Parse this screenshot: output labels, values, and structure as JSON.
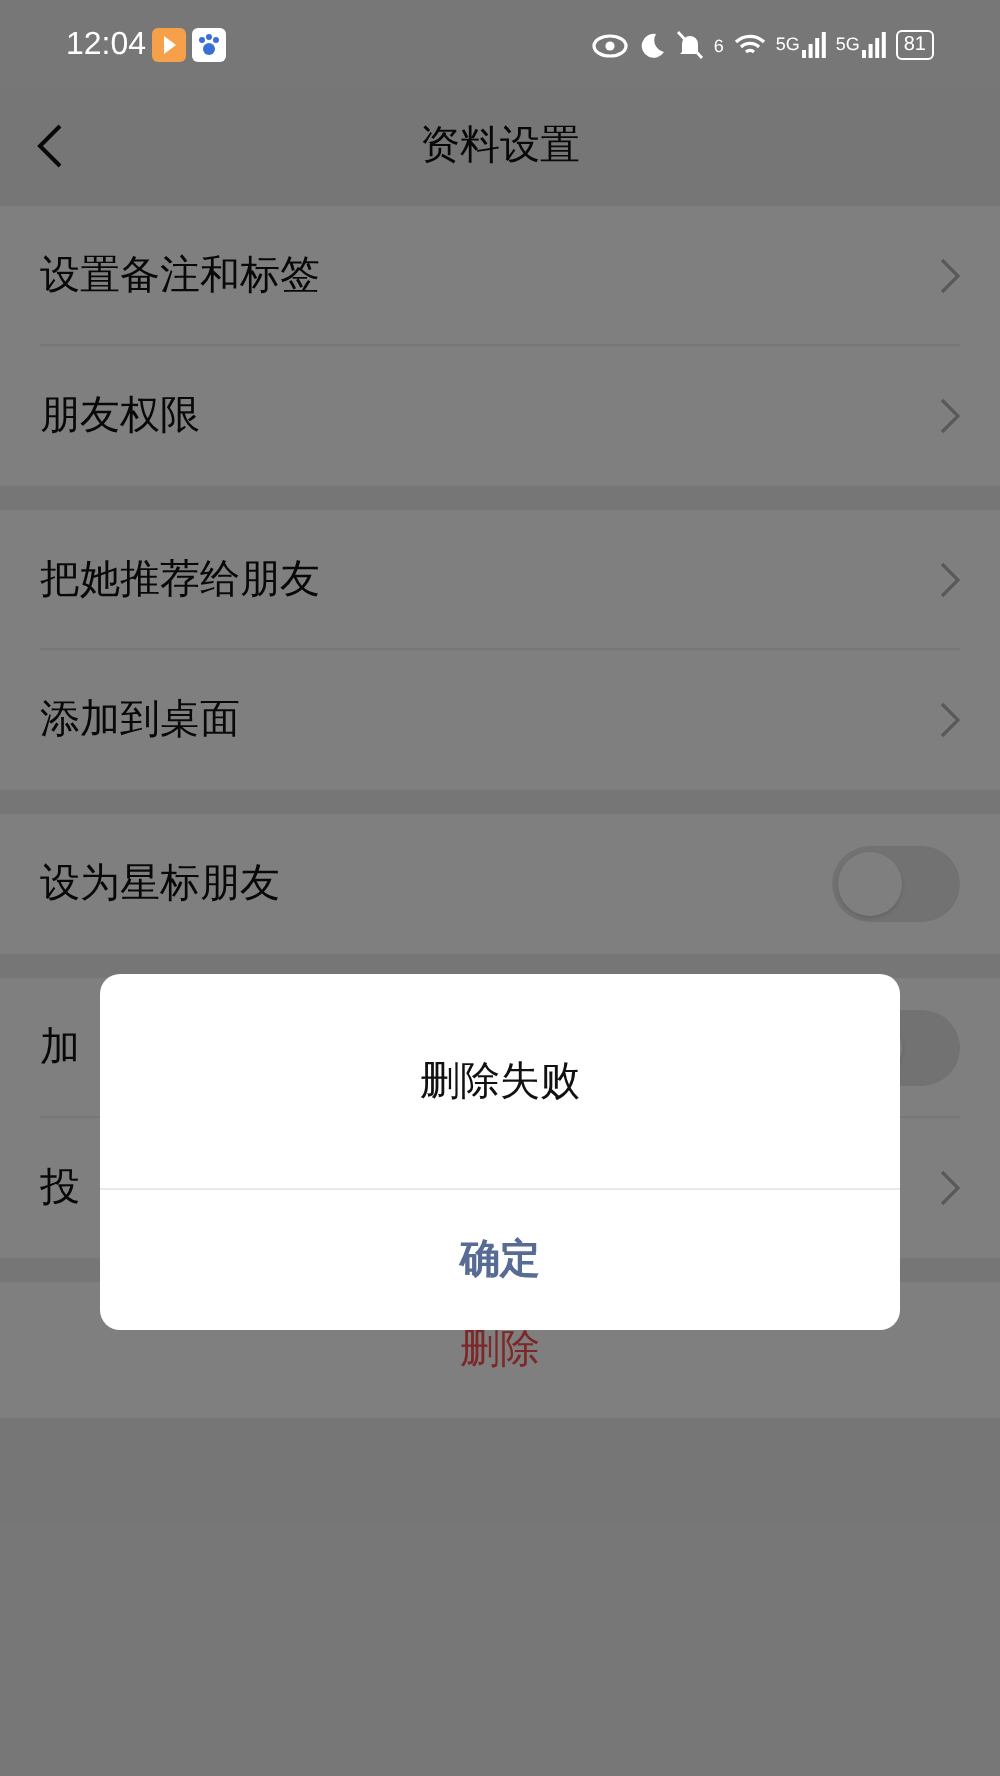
{
  "status_bar": {
    "time": "12:04",
    "network_labels": [
      "6",
      "5G",
      "5G"
    ],
    "battery": "81"
  },
  "header": {
    "title": "资料设置"
  },
  "sections": [
    {
      "rows": [
        {
          "kind": "link",
          "label": "设置备注和标签"
        },
        {
          "kind": "link",
          "label": "朋友权限"
        }
      ]
    },
    {
      "rows": [
        {
          "kind": "link",
          "label": "把她推荐给朋友"
        },
        {
          "kind": "link",
          "label": "添加到桌面"
        }
      ]
    },
    {
      "rows": [
        {
          "kind": "toggle",
          "label": "设为星标朋友",
          "on": false
        }
      ]
    },
    {
      "rows": [
        {
          "kind": "toggle",
          "label": "加",
          "on": false
        },
        {
          "kind": "link",
          "label": "投"
        }
      ]
    }
  ],
  "delete_button": {
    "label": "删除"
  },
  "dialog": {
    "message": "删除失败",
    "button": "确定"
  }
}
